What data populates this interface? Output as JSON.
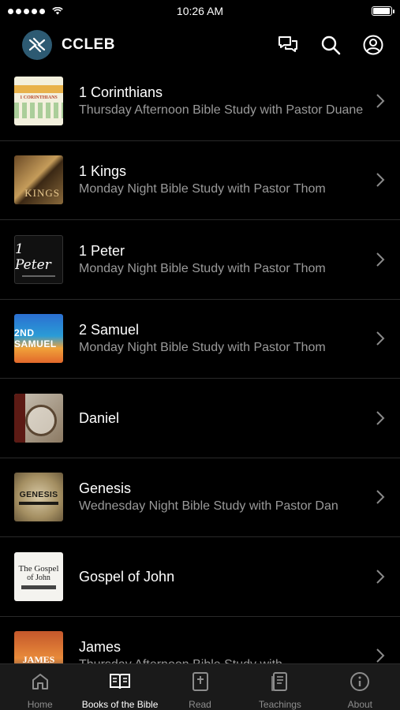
{
  "status_bar": {
    "time": "10:26 AM",
    "battery_level": 0.92
  },
  "header": {
    "title": "CCLEB",
    "logo_icon": "ccleb-logo-icon",
    "actions": [
      "chat-icon",
      "search-icon",
      "account-icon"
    ]
  },
  "list": [
    {
      "title": "1 Corinthians",
      "subtitle": "Thursday Afternoon Bible Study with Pastor Duane",
      "thumb_text": "1 CORINTHIANS"
    },
    {
      "title": "1 Kings",
      "subtitle": "Monday Night Bible Study with Pastor Thom",
      "thumb_text": "KINGS"
    },
    {
      "title": "1 Peter",
      "subtitle": "Monday Night Bible Study with Pastor Thom",
      "thumb_text": "1 Peter"
    },
    {
      "title": "2 Samuel",
      "subtitle": "Monday Night Bible Study with Pastor Thom",
      "thumb_text": "2ND SAMUEL"
    },
    {
      "title": "Daniel",
      "subtitle": "",
      "thumb_text": ""
    },
    {
      "title": "Genesis",
      "subtitle": "Wednesday Night Bible Study with Pastor Dan",
      "thumb_text": "GENESIS"
    },
    {
      "title": "Gospel of John",
      "subtitle": "",
      "thumb_text_1": "The Gospel",
      "thumb_text_2": "of John"
    },
    {
      "title": "James",
      "subtitle": "Thursday Afternoon Bible Study with",
      "thumb_text": "JAMES"
    }
  ],
  "tabs": [
    {
      "label": "Home",
      "icon": "home-icon",
      "active": false
    },
    {
      "label": "Books of the Bible",
      "icon": "book-open-icon",
      "active": true
    },
    {
      "label": "Read",
      "icon": "bible-icon",
      "active": false
    },
    {
      "label": "Teachings",
      "icon": "teachings-icon",
      "active": false
    },
    {
      "label": "About",
      "icon": "info-icon",
      "active": false
    }
  ]
}
